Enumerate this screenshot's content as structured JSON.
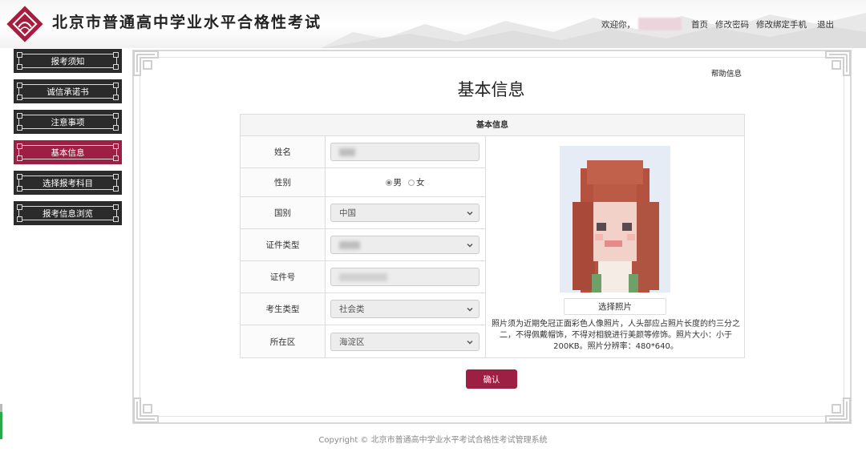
{
  "header": {
    "site_title": "北京市普通高中学业水平合格性考试",
    "welcome": "欢迎你，",
    "nav": [
      "首页",
      "修改密码",
      "修改绑定手机",
      "退出"
    ]
  },
  "sidebar": {
    "items": [
      {
        "label": "报考须知",
        "active": false
      },
      {
        "label": "诚信承诺书",
        "active": false
      },
      {
        "label": "注意事项",
        "active": false
      },
      {
        "label": "基本信息",
        "active": true
      },
      {
        "label": "选择报考科目",
        "active": false
      },
      {
        "label": "报考信息浏览",
        "active": false
      }
    ]
  },
  "main": {
    "help_link": "帮助信息",
    "page_title": "基本信息",
    "table_title": "基本信息",
    "fields": {
      "name_label": "姓名",
      "gender_label": "性别",
      "gender_male": "男",
      "gender_female": "女",
      "country_label": "国别",
      "country_value": "中国",
      "id_type_label": "证件类型",
      "id_no_label": "证件号",
      "candidate_type_label": "考生类型",
      "candidate_type_value": "社会类",
      "district_label": "所在区",
      "district_value": "海淀区"
    },
    "choose_photo": "选择照片",
    "photo_note": "照片须为近期免冠正面彩色人像照片，人头部应占照片长度的约三分之二，不得佩戴帽饰，不得对相貌进行美颜等修饰。照片大小：小于200KB。照片分辨率：480*640。",
    "confirm": "确认"
  },
  "footer": {
    "copyright": "Copyright © 北京市普通高中学业水平考试合格性考试管理系统"
  },
  "colors": {
    "accent": "#9d1f43",
    "sidebar_bg": "#2b2b2b"
  }
}
